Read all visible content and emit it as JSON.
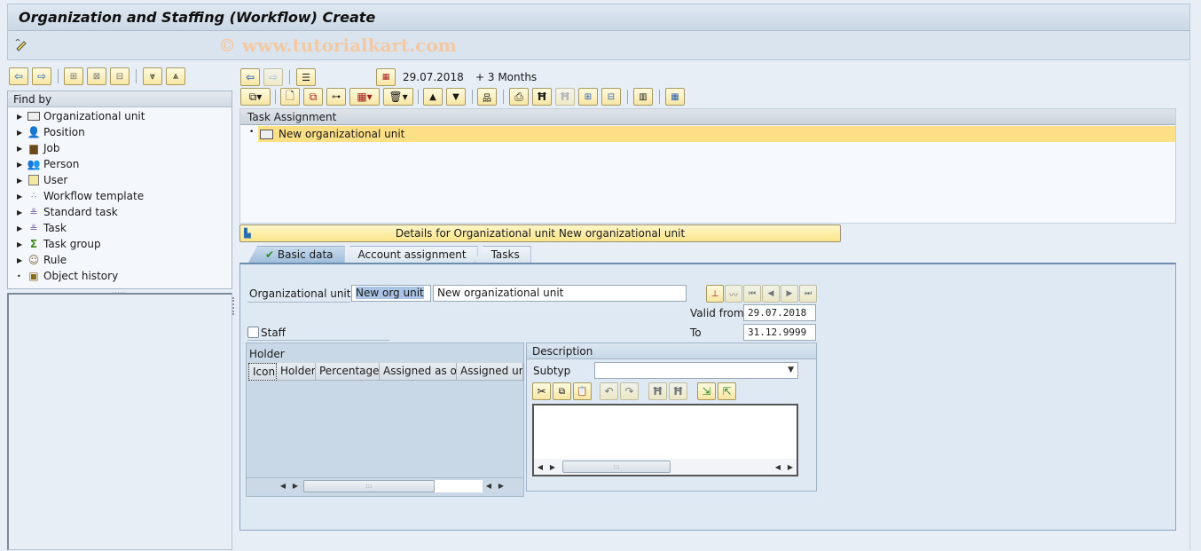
{
  "window": {
    "title": "Organization and Staffing (Workflow) Create"
  },
  "watermark": "© www.tutorialkart.com",
  "app_toolbar": {
    "icon": "pencil-icon"
  },
  "left_toolbar": [
    {
      "name": "back-button",
      "icon": "arrow-left-icon"
    },
    {
      "name": "forward-button",
      "icon": "arrow-right-icon"
    },
    {
      "name": "create-button",
      "icon": "new-object-icon"
    },
    {
      "name": "select-button",
      "icon": "object-icon"
    },
    {
      "name": "delete-button",
      "icon": "delete-object-icon"
    },
    {
      "name": "expand-button",
      "icon": "expand-icon"
    },
    {
      "name": "collapse-button",
      "icon": "collapse-icon"
    }
  ],
  "find_by": {
    "header": "Find by",
    "items": [
      {
        "label": "Organizational unit",
        "icon": "org-unit-icon",
        "expandable": true
      },
      {
        "label": "Position",
        "icon": "position-icon",
        "expandable": true
      },
      {
        "label": "Job",
        "icon": "job-icon",
        "expandable": true
      },
      {
        "label": "Person",
        "icon": "person-icon",
        "expandable": true
      },
      {
        "label": "User",
        "icon": "user-icon",
        "expandable": true
      },
      {
        "label": "Workflow template",
        "icon": "workflow-template-icon",
        "expandable": true
      },
      {
        "label": "Standard task",
        "icon": "standard-task-icon",
        "expandable": true
      },
      {
        "label": "Task",
        "icon": "task-icon",
        "expandable": true
      },
      {
        "label": "Task group",
        "icon": "task-group-icon",
        "expandable": true
      },
      {
        "label": "Rule",
        "icon": "rule-icon",
        "expandable": true
      },
      {
        "label": "Object history",
        "icon": "object-history-icon",
        "expandable": false
      }
    ]
  },
  "right_toolbar": {
    "date": "29.07.2018",
    "period": "+ 3 Months"
  },
  "task_assignment": {
    "header": "Task Assignment",
    "rows": [
      {
        "label": "New organizational unit",
        "icon": "org-unit-icon",
        "selected": true
      }
    ]
  },
  "details_bar": "Details for Organizational unit New organizational unit",
  "tabs": [
    {
      "label": "Basic data",
      "active": true,
      "icon": "checkmark-icon"
    },
    {
      "label": "Account assignment",
      "active": false
    },
    {
      "label": "Tasks",
      "active": false
    }
  ],
  "basic_data": {
    "org_unit_label": "Organizational unit",
    "org_unit_short": "New org unit",
    "org_unit_long": "New organizational unit",
    "valid_from_label": "Valid from",
    "valid_from": "29.07.2018",
    "to_label": "To",
    "to": "31.12.9999",
    "staff_label": "Staff",
    "staff_checked": false
  },
  "holder": {
    "title": "Holder",
    "columns": [
      "Icon",
      "Holder",
      "Percentage",
      "Assigned as of",
      "Assigned unti"
    ]
  },
  "description": {
    "title": "Description",
    "subtype_label": "Subtyp",
    "subtype_value": ""
  }
}
